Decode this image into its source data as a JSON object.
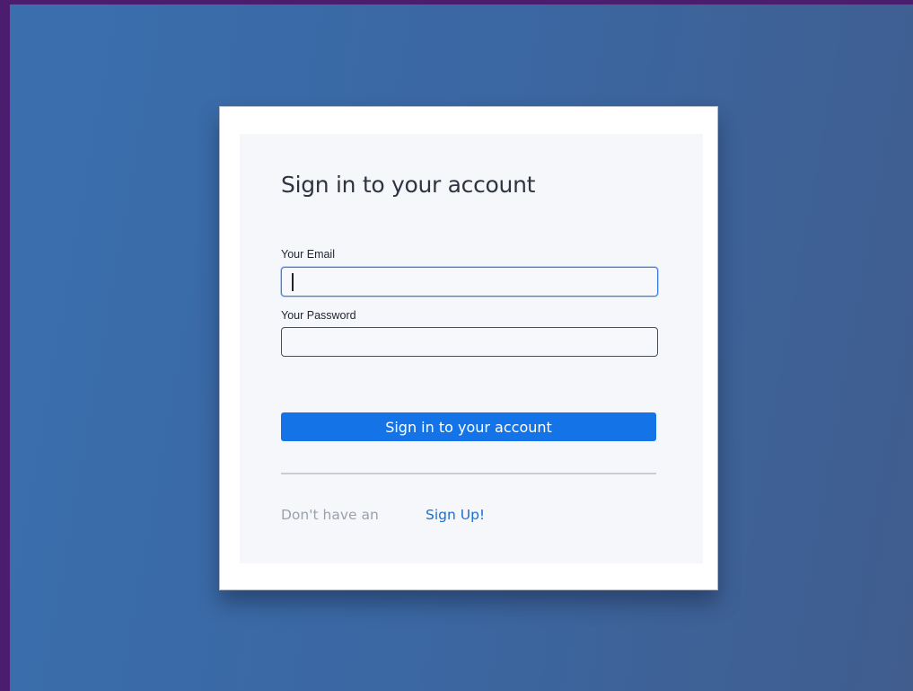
{
  "login": {
    "title": "Sign in to your account",
    "email_label": "Your Email",
    "email_value": "",
    "password_label": "Your Password",
    "password_value": "",
    "submit_label": "Sign in to your account",
    "signup_prompt": "Don't have an",
    "signup_link": "Sign Up!"
  },
  "colors": {
    "accent": "#1473e6",
    "link": "#1c6fd1",
    "focus_border": "#3d80df",
    "background_gradient_start": "#3a6fae",
    "background_gradient_end": "#405d8e"
  }
}
